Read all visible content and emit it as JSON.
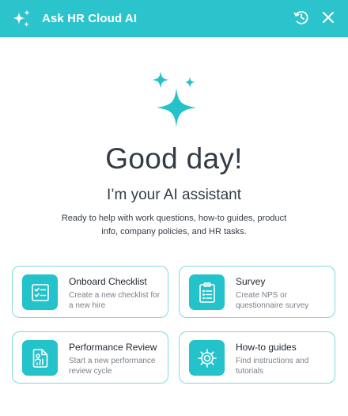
{
  "header": {
    "title": "Ask HR Cloud AI",
    "logo_icon": "sparkles-icon",
    "history_icon": "history-icon",
    "close_icon": "close-icon",
    "background_color": "#2cc4cc"
  },
  "hero": {
    "icon": "sparkles-icon",
    "greeting": "Good day!",
    "subtitle": "I’m your AI assistant",
    "description": "Ready to help with work questions, how-to guides, product info, company policies, and HR tasks."
  },
  "cards": [
    {
      "icon": "checklist-icon",
      "title": "Onboard Checklist",
      "description": "Create a new checklist for a new hire"
    },
    {
      "icon": "clipboard-icon",
      "title": "Survey",
      "description": "Create NPS or questionnaire survey"
    },
    {
      "icon": "performance-chart-icon",
      "title": "Performance Review",
      "description": "Start a new performance review cycle"
    },
    {
      "icon": "gear-icon",
      "title": "How-to guides",
      "description": "Find instructions and tutorials"
    }
  ],
  "colors": {
    "accent": "#2cc4cc",
    "card_border": "#7fdade",
    "text_dark": "#333b45",
    "text_muted": "#7a8189"
  }
}
